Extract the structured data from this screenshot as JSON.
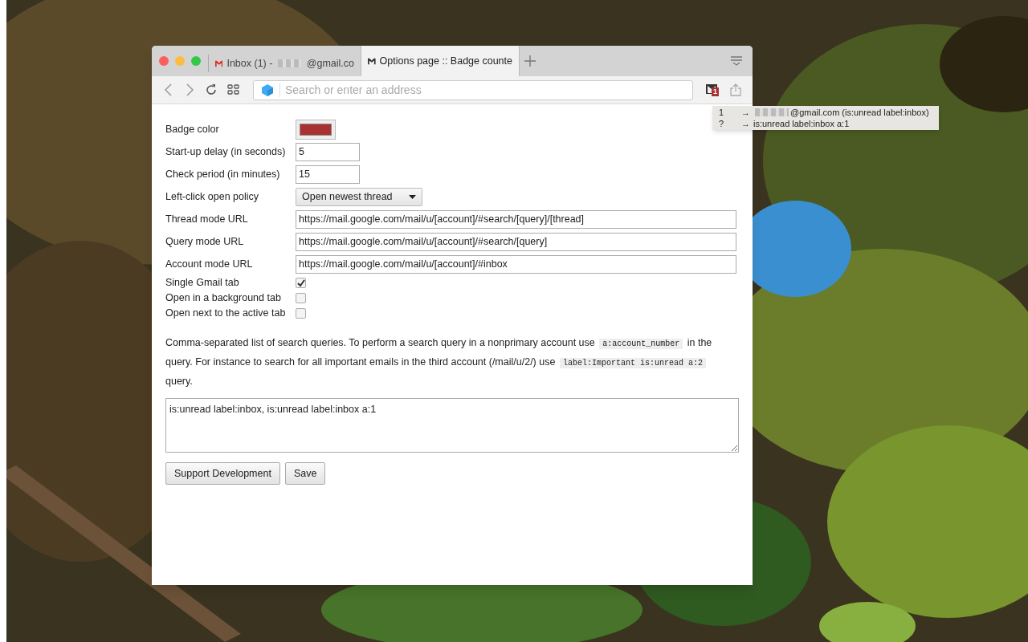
{
  "tabs": [
    {
      "kind": "blurred",
      "label": "Inbox (1) -",
      "suffix": "@gmail.co",
      "selected": false
    },
    {
      "kind": "plain",
      "label": "Options page :: Badge counte",
      "selected": true
    }
  ],
  "address_bar": {
    "placeholder": "Search or enter an address"
  },
  "extension_badge": "1",
  "popup": {
    "rows": [
      {
        "key": "1",
        "arrow": "→",
        "blurred": true,
        "text": "@gmail.com (is:unread label:inbox)"
      },
      {
        "key": "?",
        "arrow": "→",
        "blurred": false,
        "text": "is:unread label:inbox a:1"
      }
    ]
  },
  "form": {
    "rows": [
      {
        "kind": "color",
        "label": "Badge color",
        "color": "#a83232"
      },
      {
        "kind": "text",
        "label": "Start-up delay (in seconds)",
        "value": "5"
      },
      {
        "kind": "text",
        "label": "Check period (in minutes)",
        "value": "15"
      },
      {
        "kind": "select",
        "label": "Left-click open policy",
        "value": "Open newest thread"
      },
      {
        "kind": "url",
        "label": "Thread mode URL",
        "value": "https://mail.google.com/mail/u/[account]/#search/[query]/[thread]"
      },
      {
        "kind": "url",
        "label": "Query mode URL",
        "value": "https://mail.google.com/mail/u/[account]/#search/[query]"
      },
      {
        "kind": "url",
        "label": "Account mode URL",
        "value": "https://mail.google.com/mail/u/[account]/#inbox"
      },
      {
        "kind": "checkbox",
        "label": "Single Gmail tab",
        "checked": true
      },
      {
        "kind": "checkbox",
        "label": "Open in a background tab",
        "checked": false
      },
      {
        "kind": "checkbox",
        "label": "Open next to the active tab",
        "checked": false
      }
    ]
  },
  "help": [
    {
      "kind": "text",
      "text": "Comma-separated list of search queries. To perform a search query in a nonprimary account use "
    },
    {
      "kind": "code",
      "text": "a:account_number"
    },
    {
      "kind": "text",
      "text": " in the query. For instance to search for all important emails in the third account (/mail/u/2/) use "
    },
    {
      "kind": "code",
      "text": "label:Important is:unread a:2"
    },
    {
      "kind": "text",
      "text": " query."
    }
  ],
  "queries": {
    "value": "is:unread label:inbox, is:unread label:inbox a:1"
  },
  "buttons": [
    "Support Development",
    "Save"
  ]
}
